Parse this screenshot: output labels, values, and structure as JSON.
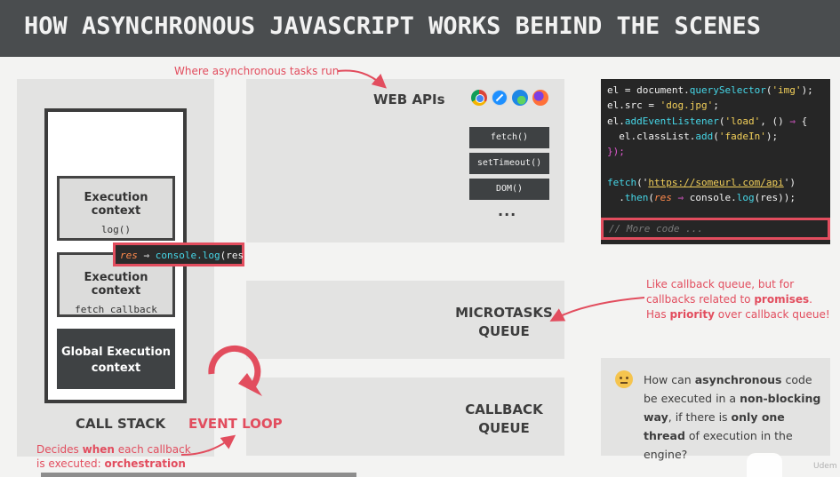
{
  "title": "HOW ASYNCHRONOUS JAVASCRIPT WORKS BEHIND THE SCENES",
  "annotations": {
    "webapis_note": "Where asynchronous tasks run",
    "microtask_note_1": "Like callback queue, but for",
    "microtask_note_2a": "callbacks related to ",
    "microtask_note_2b": "promises",
    "microtask_note_2c": ".",
    "microtask_note_3a": "Has ",
    "microtask_note_3b": "priority",
    "microtask_note_3c": " over callback queue!",
    "eventloop_note_1a": "Decides ",
    "eventloop_note_1b": "when",
    "eventloop_note_1c": " each callback",
    "eventloop_note_2a": "is executed: ",
    "eventloop_note_2b": "orchestration"
  },
  "call_stack": {
    "label": "CALL STACK",
    "contexts": [
      {
        "title": "Execution context",
        "sub": "log()"
      },
      {
        "title": "Execution context",
        "sub": "fetch callback"
      },
      {
        "title": "Global Execution context",
        "sub": ""
      }
    ],
    "pending_callback": {
      "param": "res",
      "arrow": "⇒",
      "call": "console.log",
      "args": "(res)"
    }
  },
  "event_loop": {
    "label": "EVENT LOOP"
  },
  "web_apis": {
    "label": "WEB APIs",
    "browsers": [
      "chrome-icon",
      "safari-icon",
      "edge-icon",
      "firefox-icon"
    ],
    "apis": [
      "fetch()",
      "setTimeout()",
      "DOM()"
    ],
    "more": "..."
  },
  "microtasks": {
    "line1": "MICROTASKS",
    "line2": "QUEUE"
  },
  "callback_queue": {
    "line1": "CALLBACK",
    "line2": "QUEUE"
  },
  "code": {
    "l1_a": "el = document.",
    "l1_b": "querySelector",
    "l1_c": "(",
    "l1_d": "'img'",
    "l1_e": ");",
    "l2_a": "el.src = ",
    "l2_b": "'dog.jpg'",
    "l2_c": ";",
    "l3_a": "el.",
    "l3_b": "addEventListener",
    "l3_c": "(",
    "l3_d": "'load'",
    "l3_e": ", () ",
    "l3_f": "⇒",
    "l3_g": " {",
    "l4_a": "  el.classList.",
    "l4_b": "add",
    "l4_c": "(",
    "l4_d": "'fadeIn'",
    "l4_e": ");",
    "l5_a": "});",
    "l7_a": "fetch",
    "l7_b": "('",
    "l7_c": "https://someurl.com/api",
    "l7_d": "')",
    "l8_a": "  .",
    "l8_b": "then",
    "l8_c": "(",
    "l8_d": "res",
    "l8_e": " ⇒ ",
    "l8_f": "console.",
    "l8_g": "log",
    "l8_h": "(res));",
    "more": "// More code ..."
  },
  "question": {
    "p1": "How can ",
    "b1": "asynchronous",
    "p2": " code be executed in a ",
    "b2": "non-blocking way",
    "p3": ", if there is ",
    "b3": "only one thread",
    "p4": " of execution in the engine?"
  },
  "watermark": "Udem",
  "colors": {
    "accent": "#e24d5e",
    "dark": "#3e4143",
    "panel": "#e3e3e2",
    "code_bg": "#262626"
  }
}
